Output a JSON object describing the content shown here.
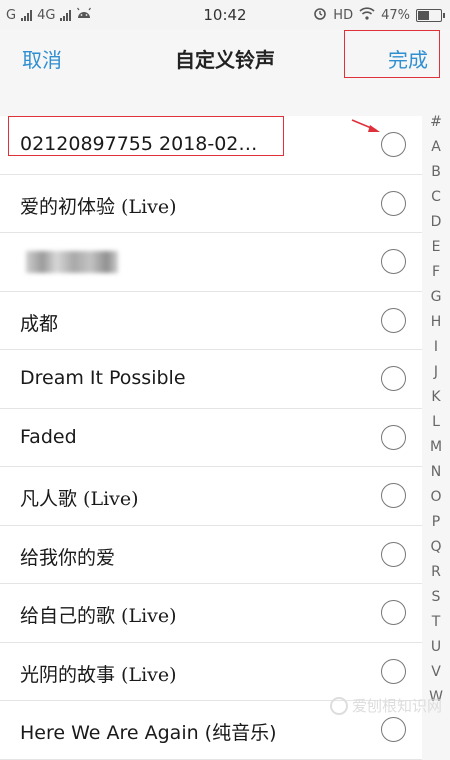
{
  "statusbar": {
    "carrier1": "G",
    "carrier2": "4G",
    "time": "10:42",
    "hd": "HD",
    "battery": "47%",
    "battery_level": 0.47
  },
  "header": {
    "cancel_label": "取消",
    "title": "自定义铃声",
    "done_label": "完成"
  },
  "list": {
    "items": [
      {
        "label": "02120897755 2018-02…"
      },
      {
        "label": "爱的初体验 (Live)"
      },
      {
        "label": ""
      },
      {
        "label": "成都"
      },
      {
        "label": "Dream It Possible"
      },
      {
        "label": "Faded"
      },
      {
        "label": "凡人歌 (Live)"
      },
      {
        "label": "给我你的爱"
      },
      {
        "label": "给自己的歌 (Live)"
      },
      {
        "label": "光阴的故事 (Live)"
      },
      {
        "label": "Here We Are Again (纯音乐)"
      }
    ]
  },
  "index": [
    "#",
    "A",
    "B",
    "C",
    "D",
    "E",
    "F",
    "G",
    "H",
    "I",
    "J",
    "K",
    "L",
    "M",
    "N",
    "O",
    "P",
    "Q",
    "R",
    "S",
    "T",
    "U",
    "V",
    "W"
  ],
  "watermark": "爱刨根知识网",
  "colors": {
    "accent": "#2f8fd0",
    "highlight": "#e0303a"
  }
}
